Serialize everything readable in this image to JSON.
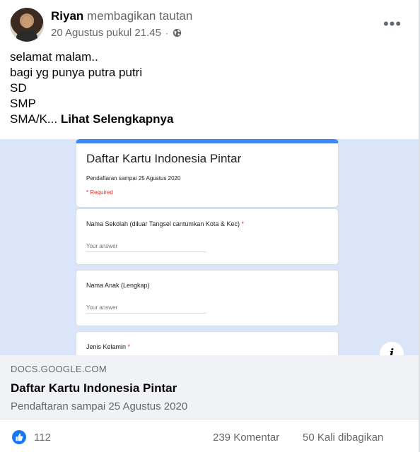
{
  "post": {
    "author": "Riyan",
    "action": "membagikan tautan",
    "timestamp": "20 Agustus pukul 21.45",
    "separator": "·",
    "privacy_icon": "globe-icon",
    "more_label": "•••",
    "text_lines": [
      "selamat malam..",
      "bagi yg punya putra putri",
      "SD",
      "SMP",
      "SMA/K..."
    ],
    "see_more": "Lihat Selengkapnya"
  },
  "preview": {
    "form_title": "Daftar Kartu Indonesia Pintar",
    "form_subtitle": "Pendaftaran sampai 25 Agustus 2020",
    "required_note": "* Required",
    "questions": [
      {
        "label": "Nama Sekolah (diluar Tangsel cantumkan Kota & Kec)",
        "required": "*",
        "answer_placeholder": "Your answer"
      },
      {
        "label": "Nama Anak (Lengkap)",
        "required": "",
        "answer_placeholder": "Your answer"
      },
      {
        "label": "Jenis Kelamin",
        "required": "*",
        "answer_placeholder": ""
      }
    ],
    "info_label": "i",
    "accent_color": "#4285f4",
    "background_color": "#dbe5f9"
  },
  "link": {
    "domain": "DOCS.GOOGLE.COM",
    "title": "Daftar Kartu Indonesia Pintar",
    "description": "Pendaftaran sampai 25 Agustus 2020"
  },
  "reactions": {
    "icon": "like-icon",
    "count": "112",
    "comments": "239 Komentar",
    "shares": "50 Kali dibagikan",
    "like_color": "#1877f2"
  }
}
